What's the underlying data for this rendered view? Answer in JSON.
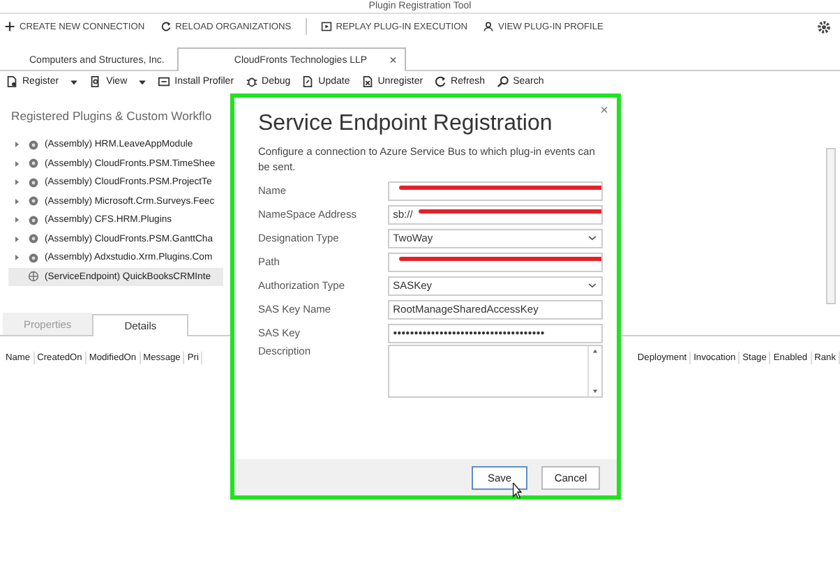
{
  "window": {
    "title": "Plugin Registration Tool"
  },
  "toolbar": [
    {
      "label": "CREATE NEW CONNECTION"
    },
    {
      "label": "RELOAD ORGANIZATIONS"
    },
    {
      "label": "REPLAY PLUG-IN EXECUTION"
    },
    {
      "label": "VIEW PLUG-IN PROFILE"
    }
  ],
  "org_tabs": [
    {
      "label": "Computers and Structures, Inc.",
      "selected": false
    },
    {
      "label": "CloudFronts Technologies LLP",
      "selected": true,
      "close": "×"
    }
  ],
  "commands": [
    {
      "label": "Register",
      "dropdown": true
    },
    {
      "label": "View",
      "dropdown": true
    },
    {
      "label": "Install Profiler",
      "dropdown": false
    },
    {
      "label": "Debug",
      "dropdown": false
    },
    {
      "label": "Update",
      "dropdown": false
    },
    {
      "label": "Unregister",
      "dropdown": false
    },
    {
      "label": "Refresh",
      "dropdown": false
    },
    {
      "label": "Search",
      "dropdown": false
    }
  ],
  "tree": {
    "heading": "Registered Plugins & Custom Workflo",
    "items": [
      {
        "label": "(Assembly) HRM.LeaveAppModule",
        "kind": "assembly",
        "selected": false
      },
      {
        "label": "(Assembly) CloudFronts.PSM.TimeShee",
        "kind": "assembly",
        "selected": false
      },
      {
        "label": "(Assembly) CloudFronts.PSM.ProjectTe",
        "kind": "assembly",
        "selected": false
      },
      {
        "label": "(Assembly) Microsoft.Crm.Surveys.Feec",
        "kind": "assembly",
        "selected": false
      },
      {
        "label": "(Assembly) CFS.HRM.Plugins",
        "kind": "assembly",
        "selected": false
      },
      {
        "label": "(Assembly) CloudFronts.PSM.GanttCha",
        "kind": "assembly",
        "selected": false
      },
      {
        "label": "(Assembly) Adxstudio.Xrm.Plugins.Com",
        "kind": "assembly",
        "selected": false
      },
      {
        "label": "(ServiceEndpoint) QuickBooksCRMInte",
        "kind": "endpoint",
        "selected": true
      }
    ]
  },
  "detail_tabs": [
    {
      "label": "Properties",
      "selected": false
    },
    {
      "label": "Details",
      "selected": true
    }
  ],
  "columns_left": [
    "Name",
    "CreatedOn",
    "ModifiedOn",
    "Message",
    "Pri"
  ],
  "columns_right": [
    "Deployment",
    "Invocation",
    "Stage",
    "Enabled",
    "Rank"
  ],
  "dialog": {
    "close": "×",
    "title": "Service Endpoint Registration",
    "description": "Configure a connection to Azure Service Bus to which plug-in events can be sent.",
    "fields": [
      {
        "label": "Name",
        "kind": "text",
        "redacted": true
      },
      {
        "label": "NameSpace Address",
        "kind": "text",
        "value": "sb://",
        "redacted": true
      },
      {
        "label": "Designation Type",
        "kind": "select",
        "value": "TwoWay"
      },
      {
        "label": "Path",
        "kind": "text",
        "redacted": true
      },
      {
        "label": "Authorization Type",
        "kind": "select",
        "value": "SASKey"
      },
      {
        "label": "SAS Key Name",
        "kind": "text",
        "value": "RootManageSharedAccessKey"
      },
      {
        "label": "SAS Key",
        "kind": "password",
        "value": "●●●●●●●●●●●●●●●●●●●●●●●●●●●●●●●●●●●●"
      },
      {
        "label": "Description",
        "kind": "textarea"
      }
    ],
    "buttons": [
      {
        "label": "Save",
        "focused": true
      },
      {
        "label": "Cancel",
        "focused": false
      }
    ]
  }
}
